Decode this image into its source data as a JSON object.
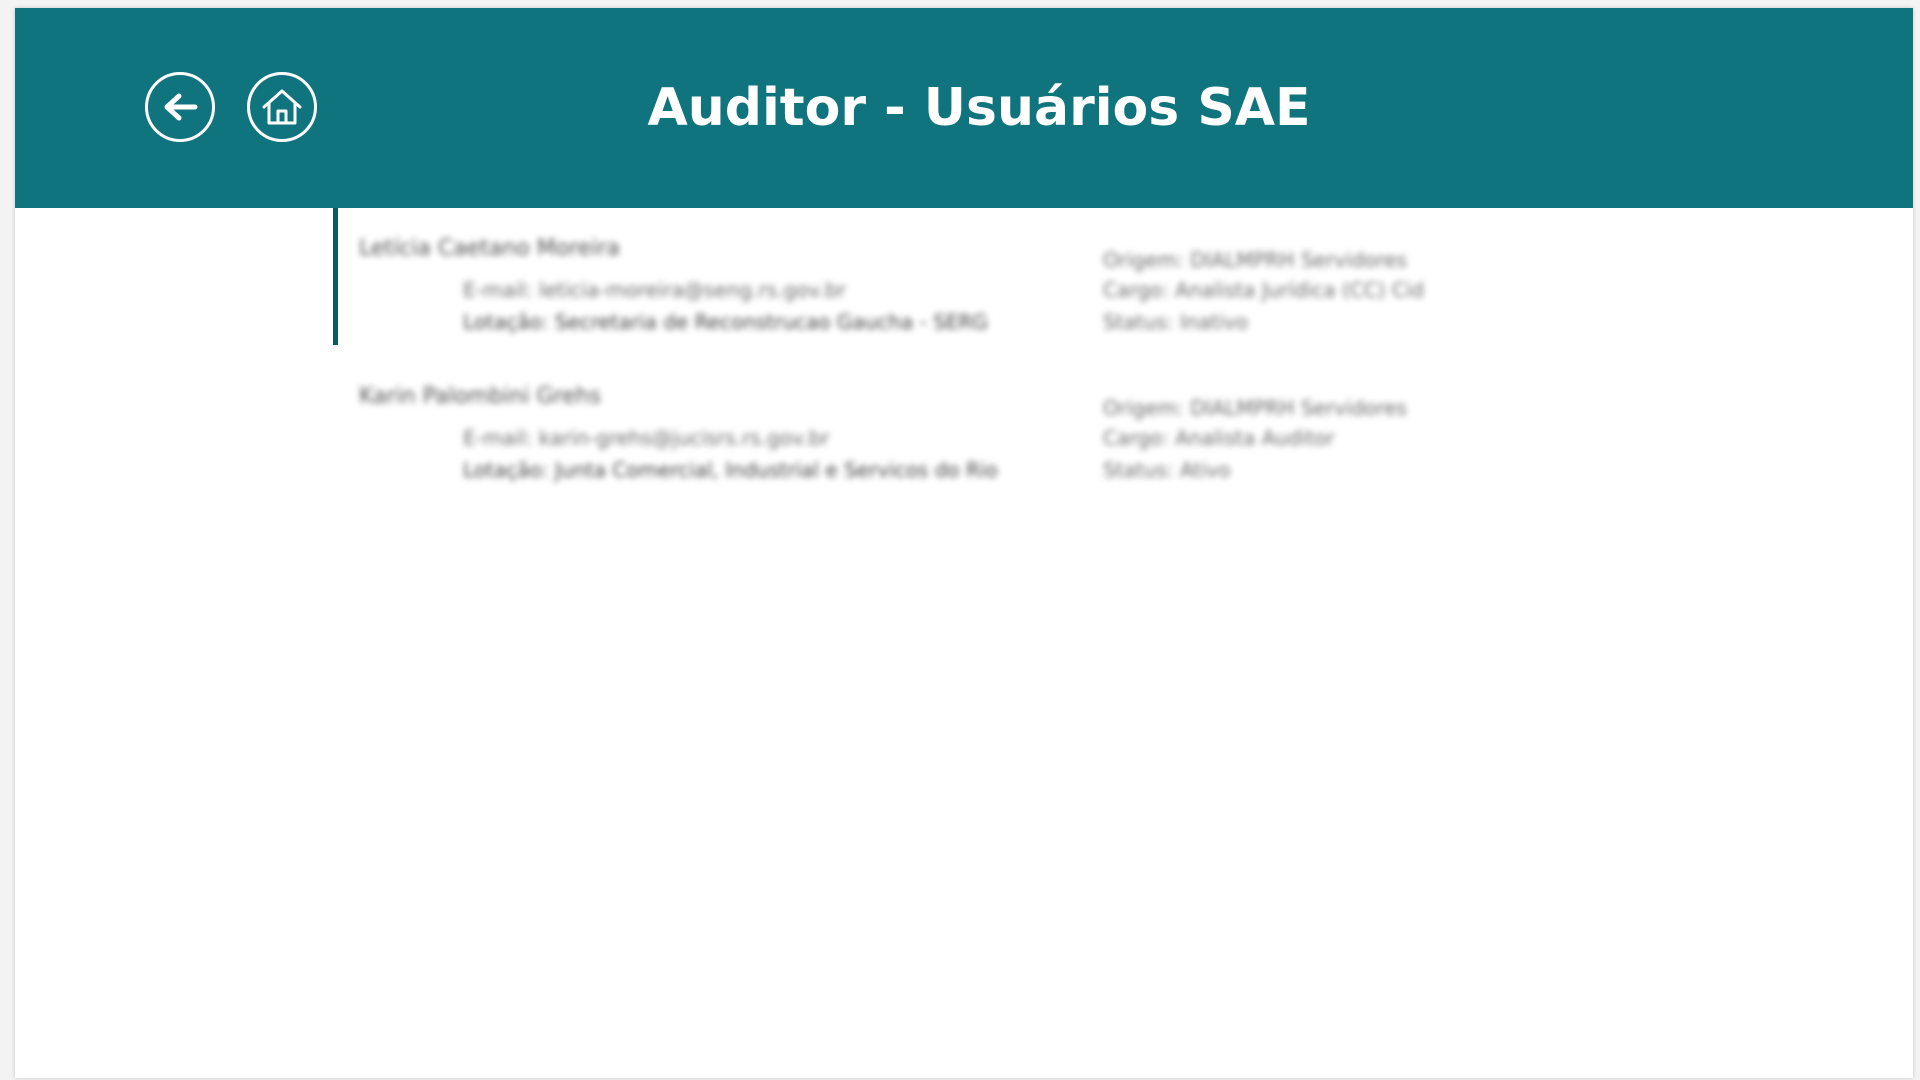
{
  "colors": {
    "header_bg": "#10747e",
    "selected_bar": "#0d5960"
  },
  "header": {
    "title": "Auditor - Usuários SAE",
    "back_icon": "arrow-left-icon",
    "home_icon": "home-icon"
  },
  "users": [
    {
      "name": "Letícia Caetano Moreira",
      "email": "E-mail: leticia-moreira@seng.rs.gov.br",
      "lotacao": "Lotação: Secretaria de Reconstrucao Gaucha - SERG",
      "origem": "Origem: DIALMPRH Servidores",
      "cargo": "Cargo: Analista Jurídica (CC) Cid",
      "status": "Status: Inativo"
    },
    {
      "name": "Karin Palombini Grehs",
      "email": "E-mail: karin-grehs@jucisrs.rs.gov.br",
      "lotacao": "Lotação: Junta Comercial, Industrial e Servicos do Rio",
      "origem": "Origem: DIALMPRH Servidores",
      "cargo": "Cargo: Analista Auditor",
      "status": "Status: Ativo"
    }
  ]
}
